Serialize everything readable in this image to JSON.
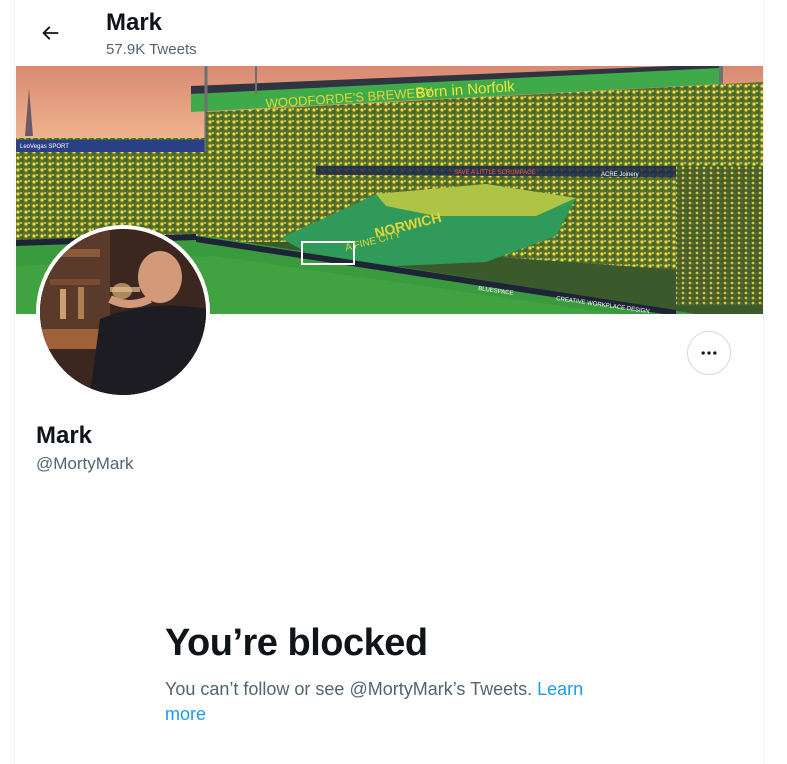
{
  "header": {
    "title": "Mark",
    "tweet_count": "57.9K Tweets"
  },
  "banner": {
    "stand_text_1": "WOODFORDE'S BREWERY",
    "stand_text_2": "Born in Norfolk",
    "board_1": "LeoVegas SPORT",
    "board_2": "SAVE A LITTLE SCRUMPAGE",
    "board_3": "ACRE Joinery",
    "board_4": "BLUESPACE",
    "board_5": "CREATIVE WORKPLACE DESIGN",
    "flag_text_1": "NORWICH",
    "flag_text_2": "A FINE CITY",
    "colors": {
      "pitch": "#2f8a3a",
      "crowd_yellow": "#e2d73a",
      "crowd_green": "#2a6b2e",
      "roof_green": "#3aa34a",
      "sky": "#e9a785"
    }
  },
  "profile": {
    "display_name": "Mark",
    "handle": "@MortyMark"
  },
  "blocked": {
    "title": "You’re blocked",
    "message": "You can’t follow or see @MortyMark’s Tweets. ",
    "link_label": "Learn more"
  },
  "icons": {
    "back": "arrow-left-icon",
    "more": "more-horizontal-icon"
  },
  "colors": {
    "text_primary": "#0f1419",
    "text_secondary": "#536471",
    "link": "#1d9bf0",
    "border": "#cfd9de"
  }
}
